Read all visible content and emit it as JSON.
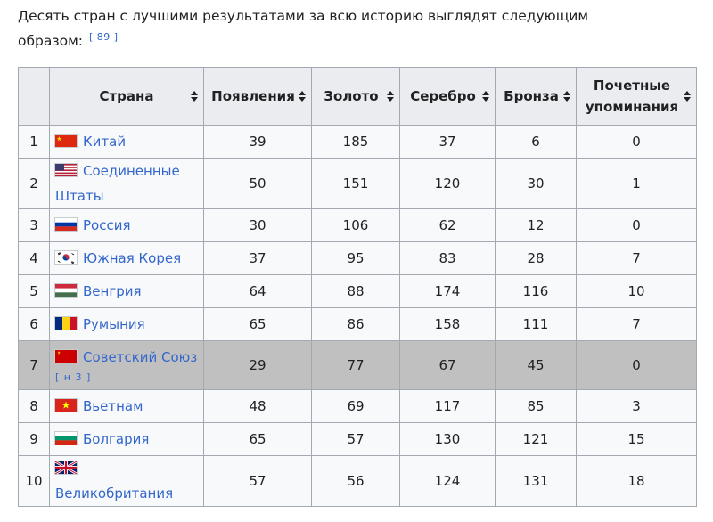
{
  "intro": {
    "text": "Десять стран с лучшими результатами за всю историю выглядят следующим образом:",
    "ref": "[ 89 ]"
  },
  "table": {
    "headers": {
      "country": "Страна",
      "appearances": "Появления",
      "gold": "Золото",
      "silver": "Серебро",
      "bronze": "Бронза",
      "honourable": "Почетные упоминания"
    },
    "rows": [
      {
        "rank": "1",
        "country": "Китай",
        "flag": "cn",
        "appearances": "39",
        "gold": "185",
        "silver": "37",
        "bronze": "6",
        "honourable": "0"
      },
      {
        "rank": "2",
        "country": "Соединенные Штаты",
        "flag": "us",
        "appearances": "50",
        "gold": "151",
        "silver": "120",
        "bronze": "30",
        "honourable": "1"
      },
      {
        "rank": "3",
        "country": "Россия",
        "flag": "ru",
        "appearances": "30",
        "gold": "106",
        "silver": "62",
        "bronze": "12",
        "honourable": "0"
      },
      {
        "rank": "4",
        "country": "Южная Корея",
        "flag": "kr",
        "appearances": "37",
        "gold": "95",
        "silver": "83",
        "bronze": "28",
        "honourable": "7"
      },
      {
        "rank": "5",
        "country": "Венгрия",
        "flag": "hu",
        "appearances": "64",
        "gold": "88",
        "silver": "174",
        "bronze": "116",
        "honourable": "10"
      },
      {
        "rank": "6",
        "country": "Румыния",
        "flag": "ro",
        "appearances": "65",
        "gold": "86",
        "silver": "158",
        "bronze": "111",
        "honourable": "7"
      },
      {
        "rank": "7",
        "country": "Советский Союз",
        "note": "[ н 3 ]",
        "flag": "su",
        "appearances": "29",
        "gold": "77",
        "silver": "67",
        "bronze": "45",
        "honourable": "0"
      },
      {
        "rank": "8",
        "country": "Вьетнам",
        "flag": "vn",
        "appearances": "48",
        "gold": "69",
        "silver": "117",
        "bronze": "85",
        "honourable": "3"
      },
      {
        "rank": "9",
        "country": "Болгария",
        "flag": "bg",
        "appearances": "65",
        "gold": "57",
        "silver": "130",
        "bronze": "121",
        "honourable": "15"
      },
      {
        "rank": "10",
        "country": "Великобритания",
        "flag": "gb",
        "appearances": "57",
        "gold": "56",
        "silver": "124",
        "bronze": "131",
        "honourable": "18"
      }
    ]
  },
  "colors": {
    "link": "#3366cc",
    "header_bg": "#eaecf0",
    "cell_bg": "#f8f9fa",
    "border": "#a2a9b1",
    "highlight_row": "#c0c0c0"
  }
}
